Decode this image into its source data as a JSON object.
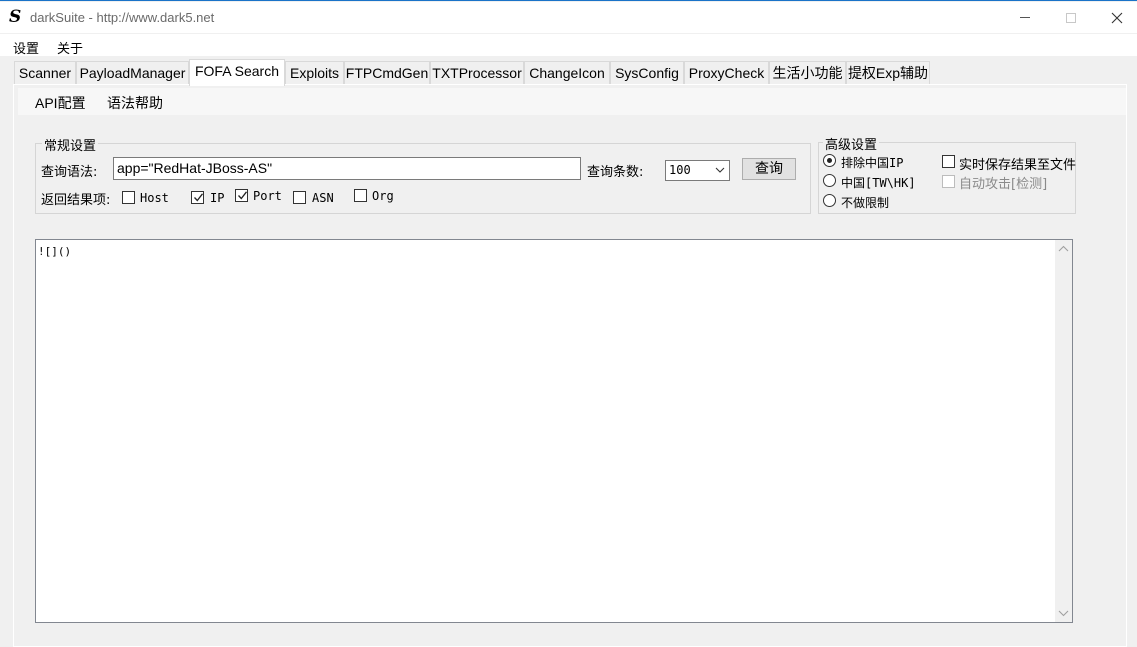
{
  "window": {
    "icon_glyph": "S",
    "title": "darkSuite - http://www.dark5.net"
  },
  "menu": [
    "设置",
    "关于"
  ],
  "tabs": [
    {
      "label": "Scanner"
    },
    {
      "label": "PayloadManager"
    },
    {
      "label": "FOFA Search",
      "active": true
    },
    {
      "label": "Exploits"
    },
    {
      "label": "FTPCmdGen"
    },
    {
      "label": "TXTProcessor"
    },
    {
      "label": "ChangeIcon"
    },
    {
      "label": "SysConfig"
    },
    {
      "label": "ProxyCheck"
    },
    {
      "label": "生活小功能"
    },
    {
      "label": "提权Exp辅助"
    }
  ],
  "subnav": [
    "API配置",
    "语法帮助"
  ],
  "general": {
    "title": "常规设置",
    "query_label": "查询语法:",
    "query_value": "app=\"RedHat-JBoss-AS\"",
    "count_label": "查询条数:",
    "count_value": "100",
    "search_button": "查询",
    "return_label": "返回结果项:",
    "fields": [
      {
        "label": "Host",
        "checked": false
      },
      {
        "label": "IP",
        "checked": true
      },
      {
        "label": "Port",
        "checked": true
      },
      {
        "label": "ASN",
        "checked": false
      },
      {
        "label": "Org",
        "checked": false
      }
    ]
  },
  "advanced": {
    "title": "高级设置",
    "radios": [
      {
        "label": "排除中国IP",
        "selected": true
      },
      {
        "label": "中国[TW\\HK]",
        "selected": false
      },
      {
        "label": "不做限制",
        "selected": false
      }
    ],
    "options": [
      {
        "label": "实时保存结果至文件",
        "checked": false,
        "disabled": false
      },
      {
        "label": "自动攻击[检测]",
        "checked": false,
        "disabled": true
      }
    ]
  },
  "result": {
    "text": "![]()"
  }
}
